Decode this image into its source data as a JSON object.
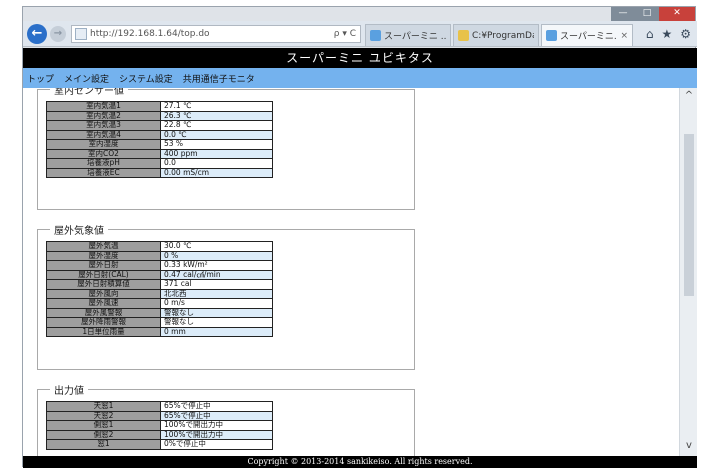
{
  "browser": {
    "back_label": "←",
    "forward_label": "→",
    "url": "http://192.168.1.64/top.do",
    "addr_controls": "ρ ▾ C",
    "tabs": [
      {
        "label": "スーパーミニ ...",
        "fav_color": "#5aa0e0"
      },
      {
        "label": "C:¥ProgramDat...",
        "fav_color": "#e8c24a"
      },
      {
        "label": "スーパーミニ...",
        "fav_color": "#5aa0e0",
        "close": "×"
      }
    ],
    "icons": {
      "home": "⌂",
      "favorites": "★",
      "settings": "⚙"
    },
    "window_controls": {
      "minimize": "—",
      "maximize": "□",
      "close": "✕"
    }
  },
  "page": {
    "title": "スーパーミニ ユビキタス",
    "menu": [
      "トップ",
      "メイン設定",
      "システム設定",
      "共用通信子モニタ"
    ],
    "indoor": {
      "legend": "室内センサー値",
      "rows": [
        {
          "label": "室内気温1",
          "value": "27.1 ℃"
        },
        {
          "label": "室内気温2",
          "value": "26.3 ℃"
        },
        {
          "label": "室内気温3",
          "value": "22.8 ℃"
        },
        {
          "label": "室内気温4",
          "value": "0.0 ℃"
        },
        {
          "label": "室内湿度",
          "value": "53 %"
        },
        {
          "label": "室内CO2",
          "value": "400 ppm"
        },
        {
          "label": "培養液pH",
          "value": "0.0"
        },
        {
          "label": "培養液EC",
          "value": "0.00 mS/cm"
        }
      ]
    },
    "outdoor": {
      "legend": "屋外気象値",
      "rows": [
        {
          "label": "屋外気温",
          "value": "30.0 ℃"
        },
        {
          "label": "屋外湿度",
          "value": "0 %"
        },
        {
          "label": "屋外日射",
          "value": "0.33 kW/m²"
        },
        {
          "label": "屋外日射(CAL)",
          "value": "0.47 cal/㎠/min"
        },
        {
          "label": "屋外日射積算値",
          "value": "371 cal"
        },
        {
          "label": "屋外風向",
          "value": "北北西"
        },
        {
          "label": "屋外風速",
          "value": "0 m/s"
        },
        {
          "label": "屋外風警報",
          "value": "警報なし"
        },
        {
          "label": "屋外降雨警報",
          "value": "警報なし"
        },
        {
          "label": "1日単位雨量",
          "value": "0 mm"
        }
      ]
    },
    "output": {
      "legend": "出力値",
      "rows": [
        {
          "label": "天窓1",
          "value": "65%で停止中"
        },
        {
          "label": "天窓2",
          "value": "65%で停止中"
        },
        {
          "label": "側窓1",
          "value": "100%で開出力中"
        },
        {
          "label": "側窓2",
          "value": "100%で開出力中"
        },
        {
          "label": "窓1",
          "value": "0%で停止中"
        }
      ]
    },
    "footer": "Copyright © 2013-2014 sankikeiso. All rights reserved."
  },
  "scrollbar": {
    "up": "^",
    "down": "v"
  }
}
